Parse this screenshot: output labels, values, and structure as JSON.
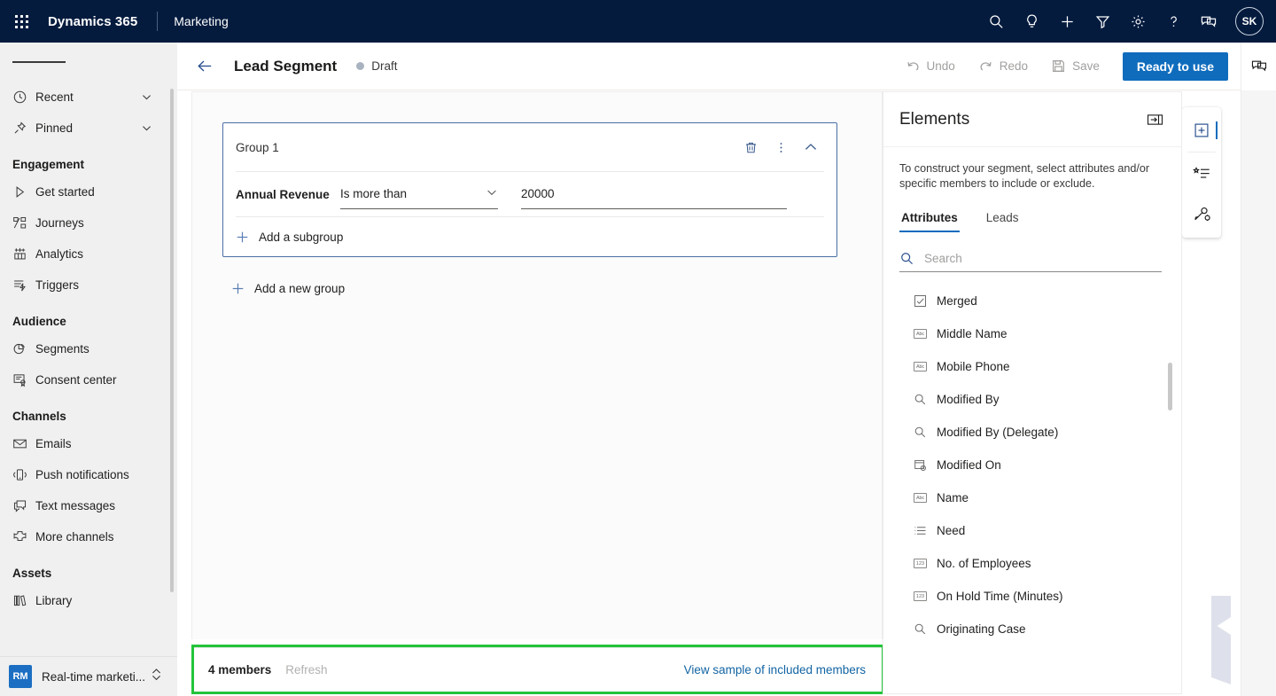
{
  "topbar": {
    "waffle_label": "App launcher",
    "brand": "Dynamics 365",
    "app_name": "Marketing",
    "icons": [
      "search-icon",
      "lightbulb-icon",
      "plus-icon",
      "filter-icon",
      "gear-icon",
      "question-icon",
      "feedback-icon"
    ],
    "avatar_initials": "SK",
    "bg_color": "#041B3E"
  },
  "sidebar": {
    "quick": [
      {
        "label": "Recent",
        "icon": "clock-icon",
        "expandable": true
      },
      {
        "label": "Pinned",
        "icon": "pin-icon",
        "expandable": true
      }
    ],
    "sections": [
      {
        "title": "Engagement",
        "items": [
          {
            "label": "Get started",
            "icon": "play-icon"
          },
          {
            "label": "Journeys",
            "icon": "journeys-icon"
          },
          {
            "label": "Analytics",
            "icon": "analytics-icon"
          },
          {
            "label": "Triggers",
            "icon": "triggers-icon"
          }
        ]
      },
      {
        "title": "Audience",
        "items": [
          {
            "label": "Segments",
            "icon": "segments-icon"
          },
          {
            "label": "Consent center",
            "icon": "consent-icon"
          }
        ]
      },
      {
        "title": "Channels",
        "items": [
          {
            "label": "Emails",
            "icon": "envelope-icon"
          },
          {
            "label": "Push notifications",
            "icon": "mobile-icon"
          },
          {
            "label": "Text messages",
            "icon": "chat-icon"
          },
          {
            "label": "More channels",
            "icon": "more-channels-icon"
          }
        ]
      },
      {
        "title": "Assets",
        "items": [
          {
            "label": "Library",
            "icon": "library-icon"
          }
        ]
      }
    ],
    "app_switcher": {
      "badge": "RM",
      "label": "Real-time marketi...",
      "badge_color": "#1b6ec2"
    }
  },
  "commandbar": {
    "back_label": "Back",
    "title": "Lead Segment",
    "status": "Draft",
    "status_color": "#a9b3c0",
    "undo_label": "Undo",
    "redo_label": "Redo",
    "save_label": "Save",
    "primary_label": "Ready to use",
    "primary_color": "#0f6cbd"
  },
  "canvas": {
    "group": {
      "title": "Group 1",
      "border_color": "#4a6fa5",
      "actions": [
        "delete-icon",
        "more-options-icon",
        "collapse-icon"
      ],
      "condition": {
        "attribute": "Annual Revenue",
        "operator": "Is more than",
        "value": "20000"
      },
      "add_subgroup_label": "Add a subgroup"
    },
    "add_new_group_label": "Add a new group"
  },
  "member_bar": {
    "count_label": "4 members",
    "refresh_label": "Refresh",
    "view_sample_label": "View sample of included members",
    "highlight_color": "#22c43a"
  },
  "elements": {
    "title": "Elements",
    "collapse_icon": "collapse-panel-icon",
    "description": "To construct your segment, select attributes and/or specific members to include or exclude.",
    "tabs": [
      {
        "label": "Attributes",
        "active": true
      },
      {
        "label": "Leads",
        "active": false
      }
    ],
    "search": {
      "placeholder": "Search",
      "icon": "search-icon"
    },
    "attributes": [
      {
        "label": "Merged",
        "icon": "checkbox-icon"
      },
      {
        "label": "Middle Name",
        "icon": "text-icon"
      },
      {
        "label": "Mobile Phone",
        "icon": "text-icon"
      },
      {
        "label": "Modified By",
        "icon": "lookup-icon"
      },
      {
        "label": "Modified By (Delegate)",
        "icon": "lookup-icon"
      },
      {
        "label": "Modified On",
        "icon": "datetime-icon"
      },
      {
        "label": "Name",
        "icon": "text-icon"
      },
      {
        "label": "Need",
        "icon": "optionset-icon"
      },
      {
        "label": "No. of Employees",
        "icon": "number-icon"
      },
      {
        "label": "On Hold Time (Minutes)",
        "icon": "number-icon"
      },
      {
        "label": "Originating Case",
        "icon": "lookup-icon"
      }
    ]
  },
  "edge_rail": {
    "top_icon": "feedback-icon",
    "items": [
      "add-element-icon",
      "favorites-list-icon",
      "personalization-icon"
    ]
  }
}
